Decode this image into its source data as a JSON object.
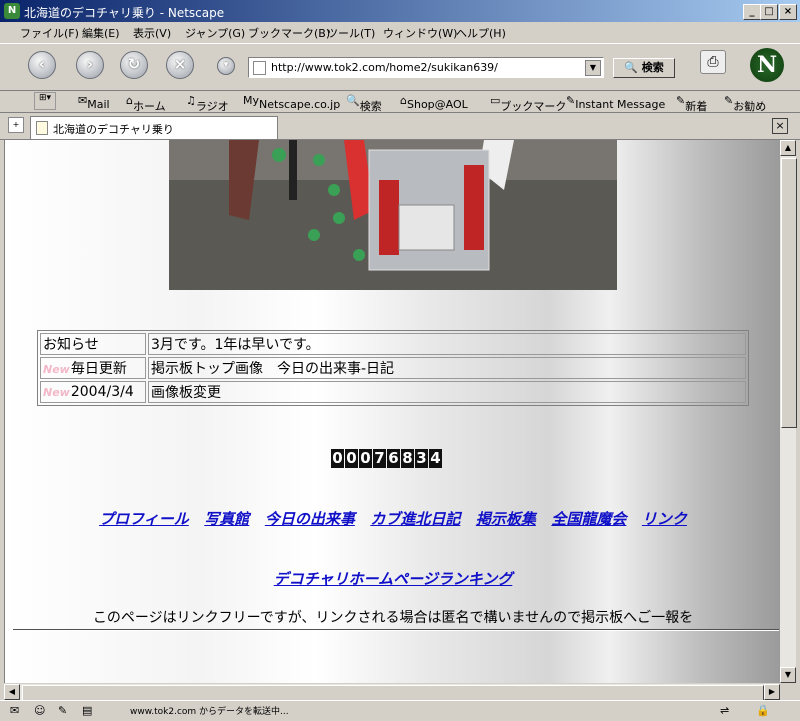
{
  "window": {
    "title": "北海道のデコチャリ乗り - Netscape",
    "app_icon": "N"
  },
  "menu": [
    "ファイル(F)",
    "編集(E)",
    "表示(V)",
    "ジャンプ(G)",
    "ブックマーク(B)",
    "ツール(T)",
    "ウィンドウ(W)",
    "ヘルプ(H)"
  ],
  "nav": {
    "url": "http://www.tok2.com/home2/sukikan639/",
    "search_label": "検索"
  },
  "personal_toolbar": [
    "Mail",
    "ホーム",
    "ラジオ",
    "Netscape.co.jp",
    "検索",
    "Shop@AOL",
    "ブックマーク",
    "Instant Message",
    "新着",
    "お勧め"
  ],
  "tab": {
    "title": "北海道のデコチャリ乗り"
  },
  "notices": [
    {
      "badge": "",
      "label": "お知らせ",
      "text": "3月です。1年は早いです。"
    },
    {
      "badge": "New",
      "label": "毎日更新",
      "text": "掲示板トップ画像　今日の出来事-日記"
    },
    {
      "badge": "New",
      "label": "2004/3/4",
      "text": "画像板変更"
    }
  ],
  "counter": "00076834",
  "links": [
    "プロフィール",
    "写真館",
    "今日の出来事",
    "カブ進北日記",
    "掲示板集",
    "全国龍魔会",
    "リンク"
  ],
  "ranking_link": "デコチャリホームページランキング",
  "footer_text": "このページはリンクフリーですが、リンクされる場合は匿名で構いませんので掲示板へご一報を",
  "status": "www.tok2.com からデータを転送中..."
}
